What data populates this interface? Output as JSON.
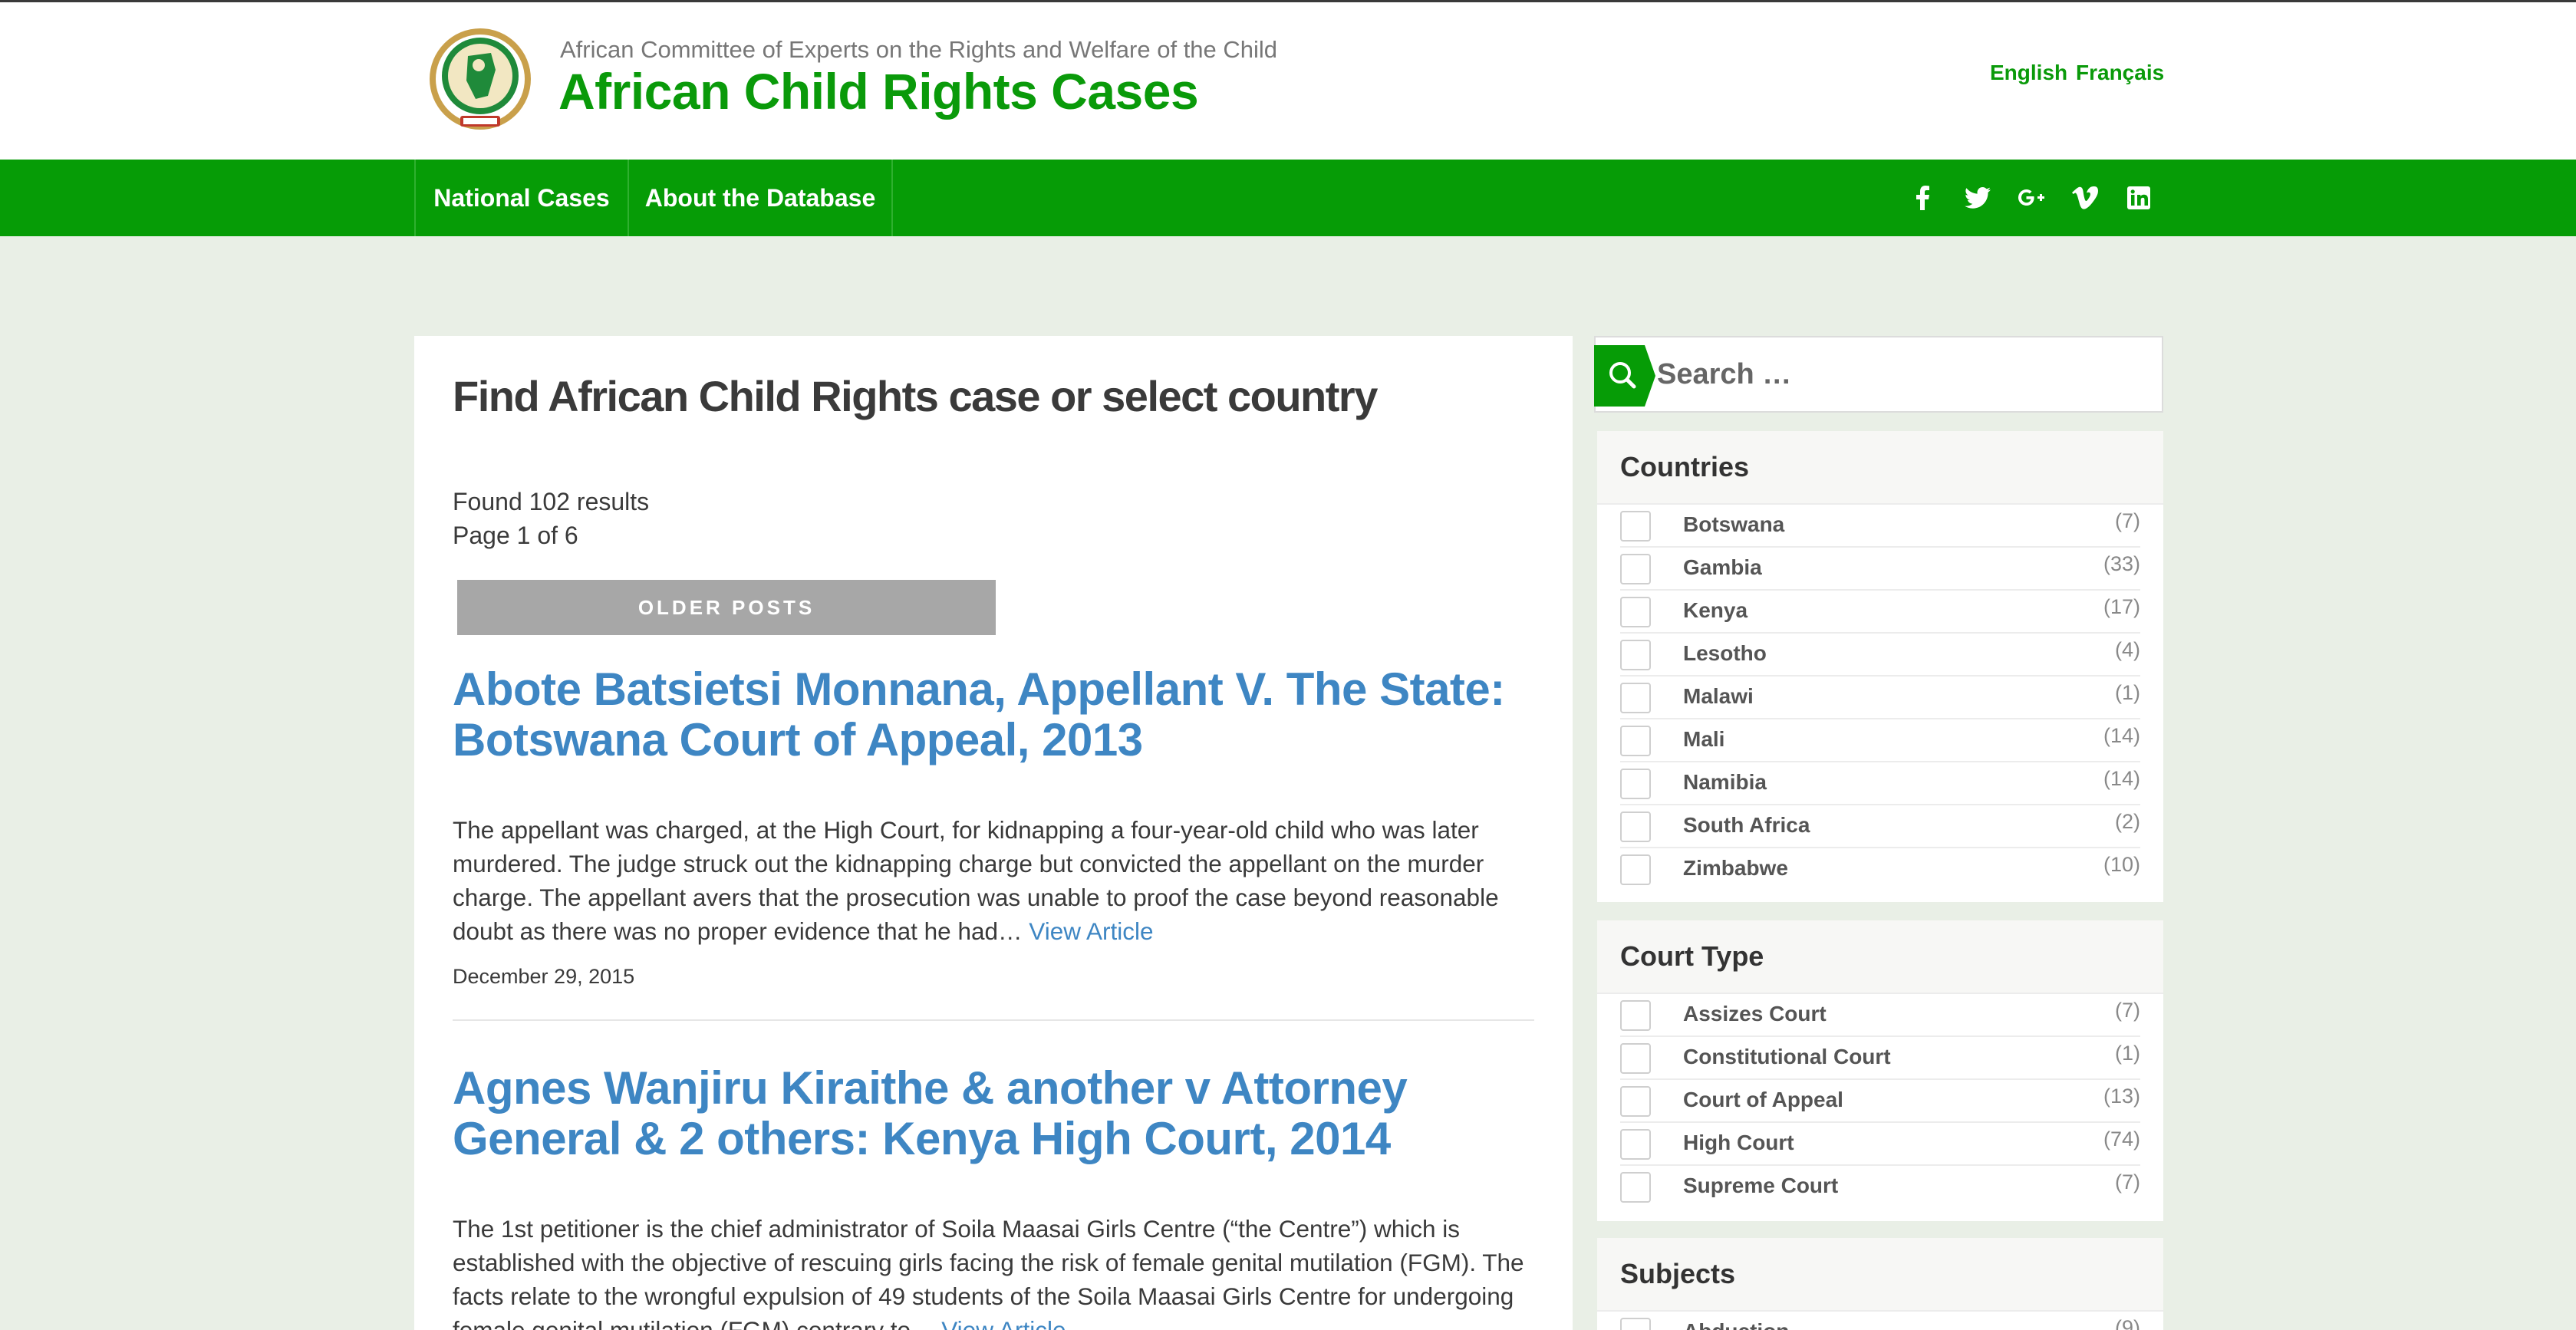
{
  "header": {
    "org_subtitle": "African Committee of Experts on the Rights and Welfare of the Child",
    "site_title": "African Child Rights Cases",
    "languages": [
      "English",
      "Français"
    ]
  },
  "nav": {
    "items": [
      "National Cases",
      "About the Database"
    ],
    "social_icons": [
      "facebook-icon",
      "twitter-icon",
      "google-plus-icon",
      "vimeo-icon",
      "linkedin-icon"
    ]
  },
  "main": {
    "heading": "Find African Child Rights case or select country",
    "found": "Found 102 results",
    "page": "Page 1 of 6",
    "older_posts": "OLDER POSTS",
    "articles": [
      {
        "title": "Abote Batsietsi Monnana, Appellant V. The State: Botswana Court of Appeal, 2013",
        "excerpt": "The appellant was charged, at the High Court, for kidnapping a four-year-old child who was later murdered. The judge struck out the kidnapping charge but convicted the appellant on the murder charge. The appellant avers that the prosecution was unable to proof the case beyond reasonable doubt as there was no proper evidence that he had…",
        "link": "View Article",
        "date": "December 29, 2015"
      },
      {
        "title": "Agnes Wanjiru Kiraithe & another v Attorney General & 2 others: Kenya High Court, 2014",
        "excerpt": "The 1st petitioner is the chief administrator of Soila Maasai Girls Centre (“the Centre”) which is established with the objective of rescuing girls facing the risk of female genital mutilation (FGM). The facts relate to the wrongful expulsion of 49 students of the Soila Maasai Girls Centre for undergoing female genital mutilation (FGM) contrary to…",
        "link": "View Article"
      }
    ]
  },
  "sidebar": {
    "search_placeholder": "Search …",
    "countries": {
      "title": "Countries",
      "items": [
        {
          "label": "Botswana",
          "count": "(7)"
        },
        {
          "label": "Gambia",
          "count": "(33)"
        },
        {
          "label": "Kenya",
          "count": "(17)"
        },
        {
          "label": "Lesotho",
          "count": "(4)"
        },
        {
          "label": "Malawi",
          "count": "(1)"
        },
        {
          "label": "Mali",
          "count": "(14)"
        },
        {
          "label": "Namibia",
          "count": "(14)"
        },
        {
          "label": "South Africa",
          "count": "(2)"
        },
        {
          "label": "Zimbabwe",
          "count": "(10)"
        }
      ]
    },
    "court_type": {
      "title": "Court Type",
      "items": [
        {
          "label": "Assizes Court",
          "count": "(7)"
        },
        {
          "label": "Constitutional Court",
          "count": "(1)"
        },
        {
          "label": "Court of Appeal",
          "count": "(13)"
        },
        {
          "label": "High Court",
          "count": "(74)"
        },
        {
          "label": "Supreme Court",
          "count": "(7)"
        }
      ]
    },
    "subjects": {
      "title": "Subjects",
      "items": [
        {
          "label": "Abduction",
          "count": "(9)"
        }
      ]
    }
  },
  "colors": {
    "brand_green": "#069c06",
    "link_blue": "#3e86c3",
    "background": "#e9efe6"
  }
}
